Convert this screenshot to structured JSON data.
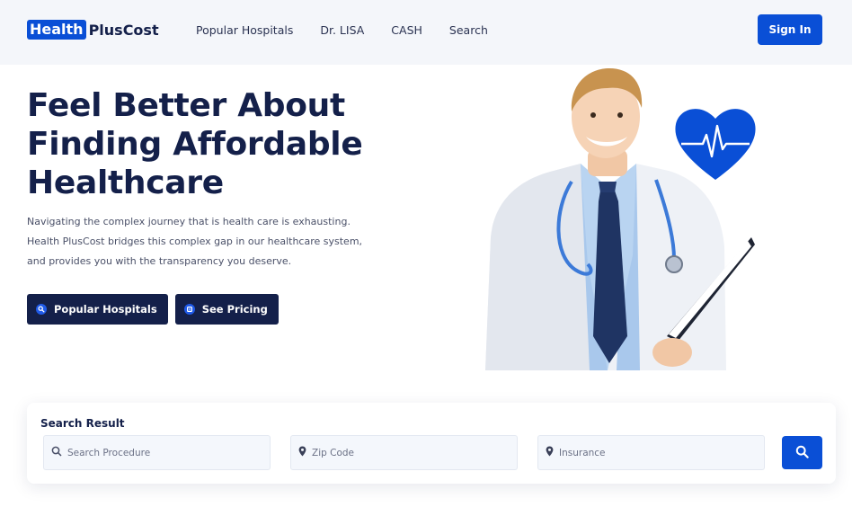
{
  "header": {
    "logo_highlight": "Health",
    "logo_rest": "PlusCost",
    "nav": [
      "Popular Hospitals",
      "Dr. LISA",
      "CASH",
      "Search"
    ],
    "signin_label": "Sign In"
  },
  "hero": {
    "title_line1": "Feel Better About",
    "title_line2": "Finding Affordable",
    "title_line3": "Healthcare",
    "desc_line1": "Navigating the complex journey that is health care is exhausting.",
    "desc_line2": "Health PlusCost bridges this complex gap in our healthcare system,",
    "desc_line3": "and provides you with the transparency you deserve.",
    "btn_hospitals": "Popular Hospitals",
    "btn_pricing": "See Pricing"
  },
  "search": {
    "title": "Search Result",
    "procedure_placeholder": "Search Procedure",
    "zip_placeholder": "Zip Code",
    "insurance_placeholder": "Insurance"
  },
  "colors": {
    "brand_blue": "#0a4fd6",
    "navy": "#14204a"
  }
}
